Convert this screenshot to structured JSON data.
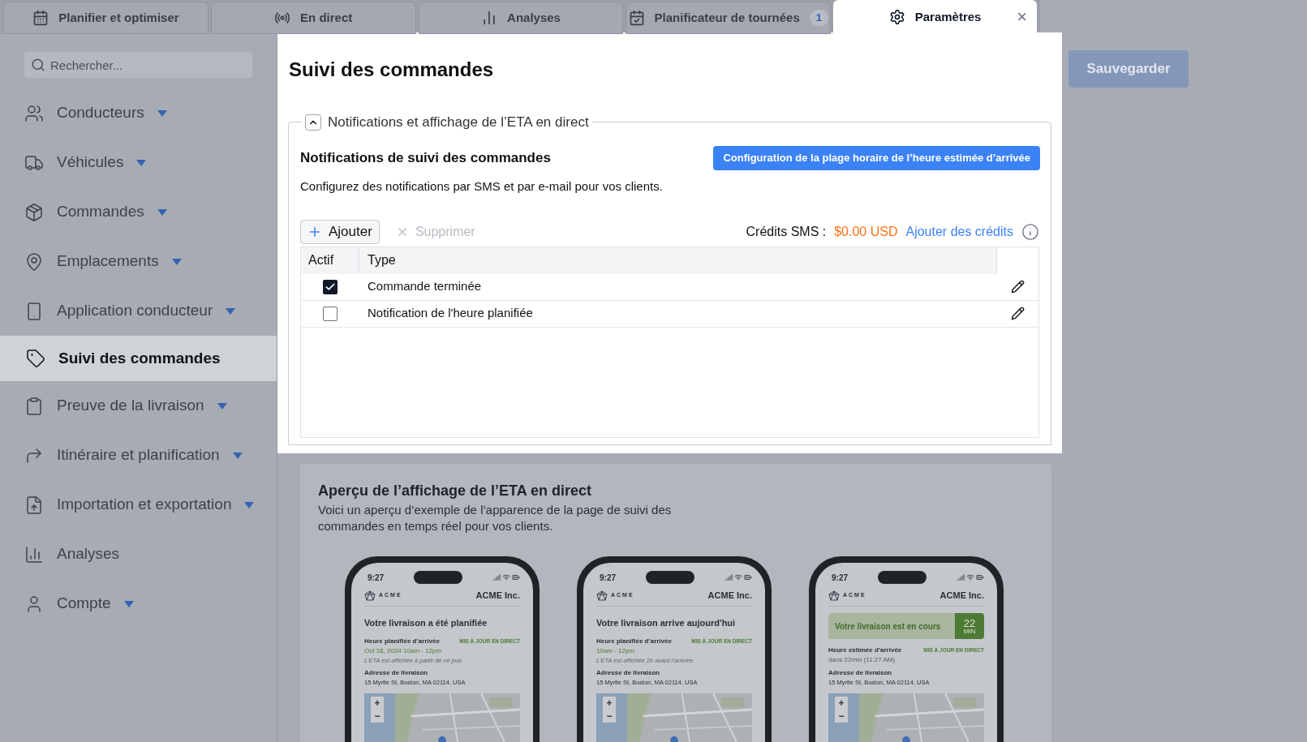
{
  "tabs": [
    {
      "label": "Planifier et optimiser",
      "selected": false
    },
    {
      "label": "En direct",
      "selected": false
    },
    {
      "label": "Analyses",
      "selected": false
    },
    {
      "label": "Planificateur de tournées",
      "badge": "1",
      "selected": false
    },
    {
      "label": "Paramètres",
      "selected": true,
      "closable": true
    }
  ],
  "close_glyph": "×",
  "sidebar": {
    "search": {
      "placeholder": "Rechercher..."
    },
    "items": [
      {
        "label": "Conducteurs",
        "expandable": true,
        "selected": false
      },
      {
        "label": "Véhicules",
        "expandable": true,
        "selected": false
      },
      {
        "label": "Commandes",
        "expandable": true,
        "selected": false
      },
      {
        "label": "Emplacements",
        "expandable": true,
        "selected": false
      },
      {
        "label": "Application conducteur",
        "expandable": true,
        "selected": false
      },
      {
        "label": "Suivi des commandes",
        "expandable": false,
        "selected": true
      },
      {
        "label": "Preuve de la livraison",
        "expandable": true,
        "selected": false
      },
      {
        "label": "Itinéraire et planification",
        "expandable": true,
        "selected": false
      },
      {
        "label": "Importation et exportation",
        "expandable": true,
        "selected": false
      },
      {
        "label": "Analyses",
        "expandable": false,
        "selected": false
      },
      {
        "label": "Compte",
        "expandable": true,
        "selected": false
      }
    ]
  },
  "page": {
    "title": "Suivi des commandes",
    "save_button": "Sauvegarder"
  },
  "section": {
    "legend": "Notifications et affichage de l’ETA en direct",
    "expanded": true,
    "heading": "Notifications de suivi des commandes",
    "description": "Configurez des notifications par SMS et par e-mail pour vos clients.",
    "eta_button": "Configuration de la plage horaire de l’heure estimée d’arrivée",
    "add_button": "Ajouter",
    "delete_button": {
      "label": "Supprimer",
      "disabled": true
    },
    "credits_label": "Crédits SMS :",
    "credits_value": "$0.00 USD",
    "credits_link": "Ajouter des crédits",
    "table": {
      "columns": [
        "Actif",
        "Type"
      ],
      "rows": [
        {
          "checked": true,
          "type": "Commande terminée"
        },
        {
          "checked": false,
          "type": "Notification de l'heure planifiée"
        }
      ]
    }
  },
  "preview": {
    "title": "Aperçu de l’affichage de l’ETA en direct",
    "description": "Voici un aperçu d’exemple de l’apparence de la page de suivi des commandes en temps réel pour vos clients.",
    "phones": [
      {
        "kind": "headline",
        "time": "9:27",
        "brand": "ACME",
        "company": "ACME Inc.",
        "headline": "Votre livraison a été planifiée",
        "eta_label": "Heure planifiée d’arrivée",
        "live": "MIS À JOUR EN DIRECT",
        "eta_value": "Oct 18, 2024 10am - 12pm",
        "note": "L’ETA est affichée à partir de ce jour.",
        "address_label": "Adresse de livraison",
        "address": "15 Myrtle St, Boston, MA 02114, USA",
        "zoom_in": "+",
        "zoom_out": "−"
      },
      {
        "kind": "headline",
        "time": "9:27",
        "brand": "ACME",
        "company": "ACME Inc.",
        "headline": "Votre livraison arrive aujourd'hui",
        "eta_label": "Heure planifiée d’arrivée",
        "live": "MIS À JOUR EN DIRECT",
        "eta_value": "10am - 12pm",
        "note": "L’ETA est affichée 2h avant l’arrivée.",
        "address_label": "Adresse de livraison",
        "address": "15 Myrtle St, Boston, MA 02114, USA",
        "zoom_in": "+",
        "zoom_out": "−"
      },
      {
        "kind": "banner",
        "time": "9:27",
        "brand": "ACME",
        "company": "ACME Inc.",
        "headline": "Votre livraison est en cours",
        "minutes": "22",
        "minutes_unit": "MIN",
        "eta_label": "Heure estimée d’arrivée",
        "live": "MIS À JOUR EN DIRECT",
        "eta_value": "dans 22min (11:27 AM)",
        "address_label": "Adresse de livraison",
        "address": "15 Myrtle St, Boston, MA 02114, USA",
        "zoom_in": "+",
        "zoom_out": "−"
      }
    ]
  }
}
